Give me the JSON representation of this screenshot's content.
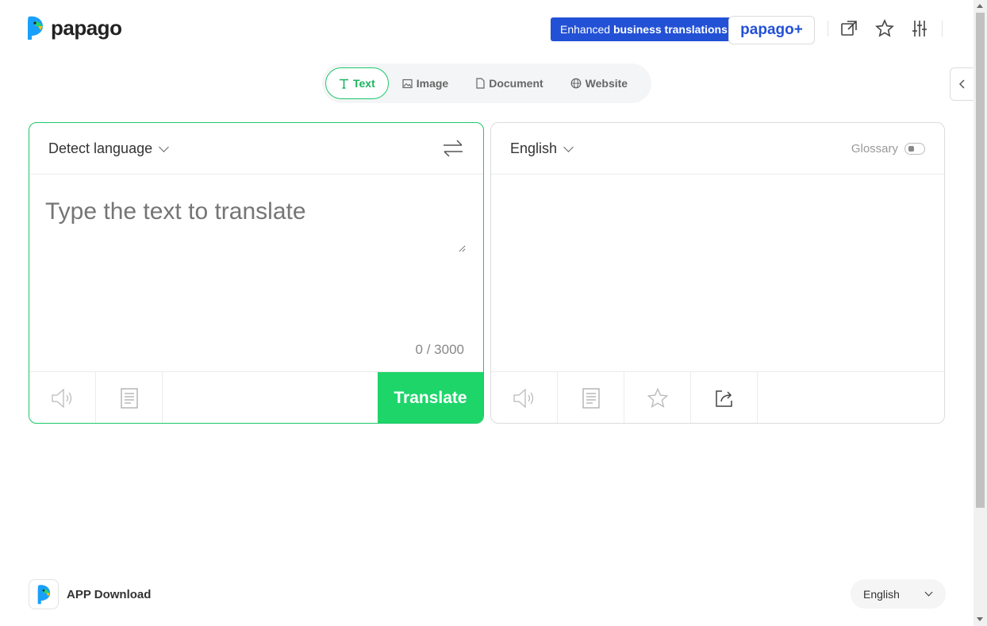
{
  "header": {
    "logo_text": "papago",
    "promo_prefix": "Enhanced",
    "promo_bold": "business translations",
    "plus_button": "papago+",
    "icons": [
      "external-link-icon",
      "star-icon",
      "settings-sliders-icon"
    ]
  },
  "tabs": [
    {
      "label": "Text",
      "icon": "text-icon",
      "active": true
    },
    {
      "label": "Image",
      "icon": "image-icon",
      "active": false
    },
    {
      "label": "Document",
      "icon": "document-icon",
      "active": false
    },
    {
      "label": "Website",
      "icon": "globe-icon",
      "active": false
    }
  ],
  "source": {
    "language": "Detect language",
    "placeholder": "Type the text to translate",
    "counter": "0 / 3000",
    "translate_button": "Translate"
  },
  "target": {
    "language": "English",
    "glossary_label": "Glossary"
  },
  "footer": {
    "app_download": "APP Download",
    "locale": "English"
  },
  "colors": {
    "brand_green": "#1ed56a",
    "promo_blue": "#2251d6"
  }
}
